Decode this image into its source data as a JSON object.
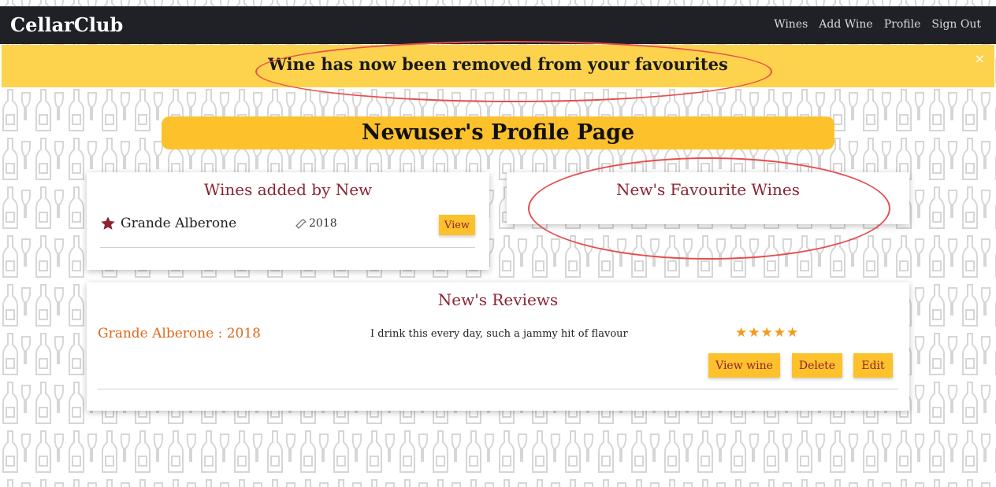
{
  "nav": {
    "brand": "CellarClub",
    "links": [
      "Wines",
      "Add Wine",
      "Profile",
      "Sign Out"
    ]
  },
  "alert": {
    "message": "Wine has now been removed from your favourites",
    "close": "×"
  },
  "page_title": "Newuser's Profile Page",
  "wines_added": {
    "title": "Wines added by New",
    "items": [
      {
        "name": "Grande Alberone",
        "year": "2018",
        "button": "View"
      }
    ]
  },
  "favourites": {
    "title": "New's Favourite Wines"
  },
  "reviews": {
    "title": "New's Reviews",
    "items": [
      {
        "wine": "Grande Alberone : 2018",
        "text": "I drink this every day, such a jammy hit of flavour",
        "rating": 5,
        "stars": "★★★★★",
        "view_button": "View wine",
        "delete_button": "Delete",
        "edit_button": "Edit"
      }
    ]
  },
  "colors": {
    "navbar": "#1f2127",
    "alert": "#fdd24c",
    "accent": "#fdc12c",
    "heading": "#8b2331",
    "wine_link": "#e0681a",
    "stars": "#f59a1a",
    "highlight": "#e84c4c"
  }
}
